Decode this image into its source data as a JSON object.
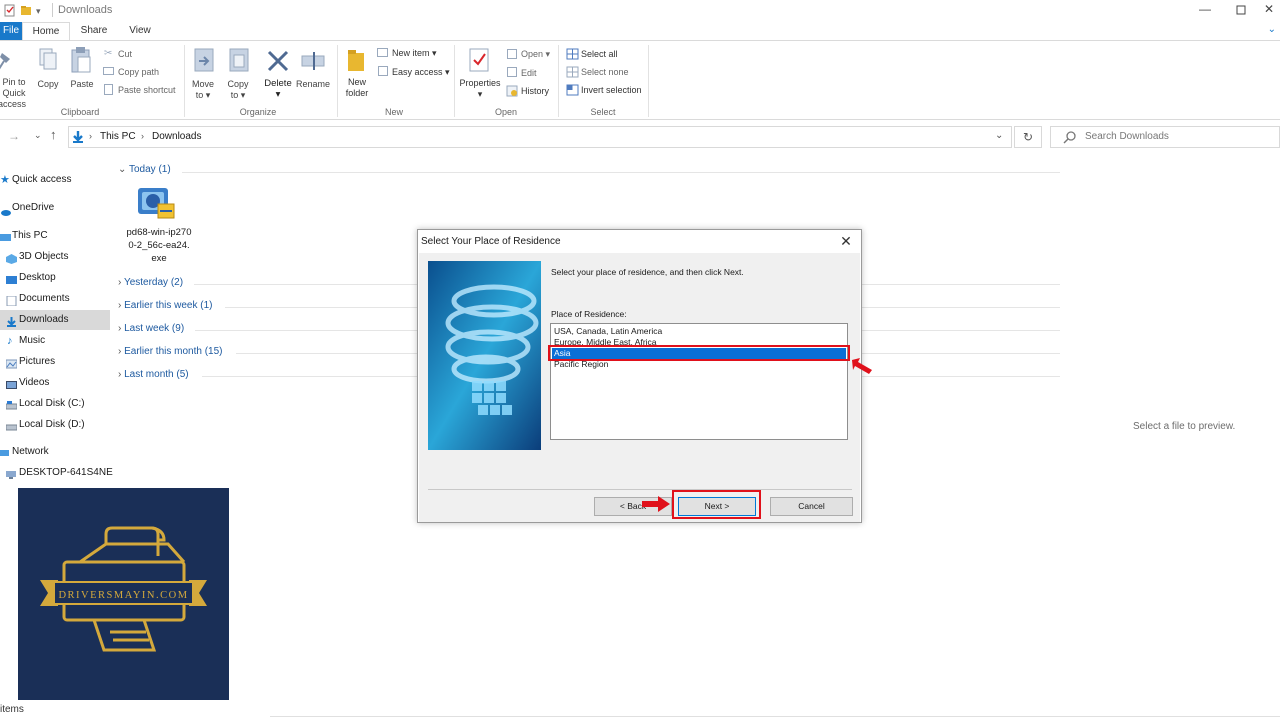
{
  "window": {
    "title": "Downloads"
  },
  "ribbon": {
    "tabs": [
      "File",
      "Home",
      "Share",
      "View"
    ],
    "clipboard": {
      "pin": [
        "Pin to Quick",
        "access"
      ],
      "copy": "Copy",
      "paste": "Paste",
      "cut": "Cut",
      "copy_path": "Copy path",
      "paste_shortcut": "Paste shortcut",
      "label": "Clipboard"
    },
    "organize": {
      "move_to": [
        "Move",
        "to"
      ],
      "copy_to": [
        "Copy",
        "to"
      ],
      "delete": "Delete",
      "rename": "Rename",
      "label": "Organize"
    },
    "new": {
      "new_folder": [
        "New",
        "folder"
      ],
      "new_item": "New item",
      "easy_access": "Easy access",
      "label": "New"
    },
    "open": {
      "properties": "Properties",
      "open": "Open",
      "edit": "Edit",
      "history": "History",
      "label": "Open"
    },
    "select": {
      "select_all": "Select all",
      "select_none": "Select none",
      "invert_selection": "Invert selection",
      "label": "Select"
    }
  },
  "address": {
    "path": [
      "This PC",
      "Downloads"
    ],
    "search_placeholder": "Search Downloads"
  },
  "nav": {
    "items": [
      {
        "label": "Quick access"
      },
      {
        "label": "OneDrive"
      },
      {
        "label": "This PC"
      },
      {
        "label": "3D Objects"
      },
      {
        "label": "Desktop"
      },
      {
        "label": "Documents"
      },
      {
        "label": "Downloads"
      },
      {
        "label": "Music"
      },
      {
        "label": "Pictures"
      },
      {
        "label": "Videos"
      },
      {
        "label": "Local Disk (C:)"
      },
      {
        "label": "Local Disk (D:)"
      },
      {
        "label": "Network"
      },
      {
        "label": "DESKTOP-641S4NE"
      }
    ]
  },
  "files": {
    "groups": [
      {
        "label": "Today (1)"
      },
      {
        "label": "Yesterday (2)"
      },
      {
        "label": "Earlier this week (1)"
      },
      {
        "label": "Last week (9)"
      },
      {
        "label": "Earlier this month (15)"
      },
      {
        "label": "Last month (5)"
      }
    ],
    "item": {
      "name": "pd68-win-ip2700-2_56c-ea24.exe"
    }
  },
  "preview": {
    "text": "Select a file to preview."
  },
  "status": {
    "text": "items"
  },
  "logo": {
    "text": "DRIVERSMAYIN.COM"
  },
  "dialog": {
    "title": "Select Your Place of Residence",
    "instruction": "Select your place of residence, and then click Next.",
    "list_label": "Place of Residence:",
    "options": [
      "USA, Canada, Latin America",
      "Europe, Middle East, Africa",
      "Asia",
      "Pacific Region"
    ],
    "selected": "Asia",
    "buttons": {
      "back": "< Back",
      "next": "Next >",
      "cancel": "Cancel"
    }
  },
  "colors": {
    "accent": "#1979ca",
    "highlight": "#e0111b",
    "selection": "#0a6fd6",
    "logo_bg": "#1a2f57",
    "logo_gold": "#d4a93c"
  }
}
